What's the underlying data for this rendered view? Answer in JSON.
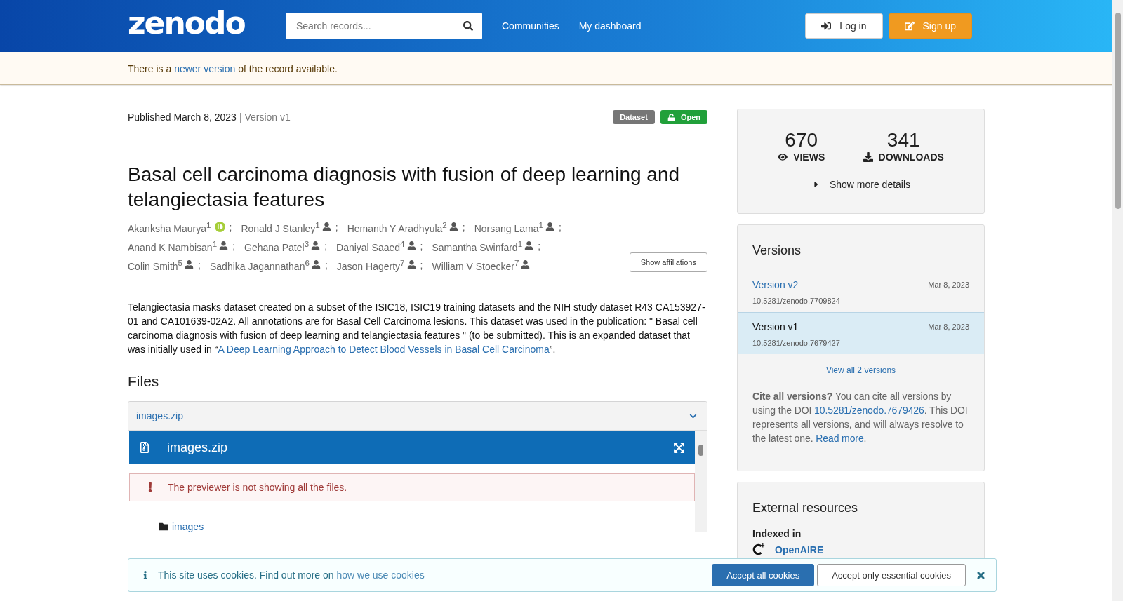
{
  "header": {
    "logo": "zenodo",
    "search": {
      "placeholder": "Search records..."
    },
    "nav": [
      "Communities",
      "My dashboard"
    ],
    "login": "Log in",
    "signup": "Sign up"
  },
  "notice": {
    "before": "There is a",
    "link": "newer version",
    "after": "of the record available."
  },
  "record": {
    "published": "Published March 8, 2023",
    "version": "| Version v1",
    "badges": [
      {
        "label": "Dataset",
        "kind": "type"
      },
      {
        "label": "Open",
        "kind": "access"
      }
    ],
    "title": "Basal cell carcinoma diagnosis with fusion of deep learning and telangiectasia features",
    "authors": [
      {
        "name": "Akanksha Maurya",
        "aff": "1",
        "kind": "orcid",
        "separator": ";"
      },
      {
        "name": "Ronald J Stanley",
        "aff": "1",
        "kind": "person",
        "separator": ";"
      },
      {
        "name": "Hemanth Y Aradhyula",
        "aff": "2",
        "kind": "person",
        "separator": ";"
      },
      {
        "name": "Norsang Lama",
        "aff": "1",
        "kind": "person",
        "separator": ";"
      },
      {
        "name": "Anand K Nambisan",
        "aff": "1",
        "kind": "person",
        "separator": ";"
      },
      {
        "name": "Gehana Patel",
        "aff": "3",
        "kind": "person",
        "separator": ";"
      },
      {
        "name": "Daniyal Saaed",
        "aff": "4",
        "kind": "person",
        "separator": ";"
      },
      {
        "name": "Samantha Swinfard",
        "aff": "1",
        "kind": "person",
        "separator": ";"
      },
      {
        "name": "Colin Smith",
        "aff": "5",
        "kind": "person",
        "separator": ";"
      },
      {
        "name": "Sadhika Jagannathan",
        "aff": "6",
        "kind": "person",
        "separator": ";"
      },
      {
        "name": "Jason Hagerty",
        "aff": "7",
        "kind": "person",
        "separator": ";"
      },
      {
        "name": "William V Stoecker",
        "aff": "7",
        "kind": "person"
      }
    ],
    "show_affiliations": "Show affiliations",
    "description": "Telangiectasia masks dataset created on a subset of the ISIC18, ISIC19 training datasets and the NIH study dataset R43 CA153927-01 and CA101639-02A2. All annotations are for Basal Cell Carcinoma lesions. This dataset was used in the publication: \" Basal cell carcinoma diagnosis with fusion of deep learning and telangiectasia features \" (to be submitted). This is an expanded dataset that was initially used in “",
    "description_link": "A Deep Learning Approach to Detect Blood Vessels in Basal Cell Carcinoma",
    "description_end": "”."
  },
  "files": {
    "heading": "Files",
    "file": "images.zip",
    "expanded": true,
    "preview_title": "images.zip",
    "alert": "The previewer is not showing all the files.",
    "folder": "images"
  },
  "stats": {
    "views": "670",
    "views_label": "VIEWS",
    "downloads": "341",
    "downloads_label": "DOWNLOADS",
    "more": "Show more details"
  },
  "versions": {
    "heading": "Versions",
    "items": [
      {
        "label": "Version v2",
        "date": "Mar 8, 2023",
        "doi": "10.5281/zenodo.7709824",
        "selected": false
      },
      {
        "label": "Version v1",
        "date": "Mar 8, 2023",
        "doi": "10.5281/zenodo.7679427",
        "selected": true
      }
    ],
    "view_all": "View all 2 versions",
    "cite_bold": "Cite all versions?",
    "cite_text": "You can cite all versions by using the DOI",
    "cite_doi": "10.5281/zenodo.7679426",
    "cite_text2": ". This DOI represents all versions, and will always resolve to the latest one.",
    "read_more": "Read more",
    "cite_end": "."
  },
  "external": {
    "heading": "External resources",
    "indexed": "Indexed in",
    "source": "OpenAIRE"
  },
  "cookies": {
    "text": "This site uses cookies. Find out more on",
    "link": "how we use cookies",
    "accept_all": "Accept all cookies",
    "accept_essential": "Accept only essential cookies"
  }
}
